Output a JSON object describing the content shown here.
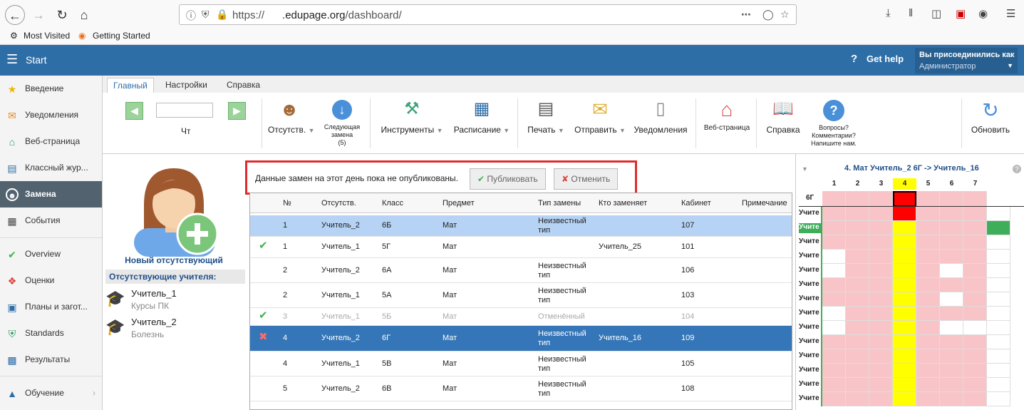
{
  "browser": {
    "url_prefix": "https://",
    "url_domain": ".edupage.org",
    "url_path": "/dashboard/",
    "bookmarks": [
      "Most Visited",
      "Getting Started"
    ]
  },
  "header": {
    "title": "Start",
    "help": "Get help",
    "user_line1": "Вы присоединились как",
    "user_role": "Администратор"
  },
  "sidebar": {
    "items": [
      {
        "label": "Введение",
        "icon": "star-icon",
        "color": "#f0b400"
      },
      {
        "label": "Уведомления",
        "icon": "envelope-icon",
        "color": "#e08a1e"
      },
      {
        "label": "Веб-страница",
        "icon": "home-icon",
        "color": "#2a9d5c"
      },
      {
        "label": "Классный жур...",
        "icon": "journal-icon",
        "color": "#2e6ea7"
      },
      {
        "label": "Замена",
        "icon": "person-icon",
        "color": "#ffffff"
      },
      {
        "label": "События",
        "icon": "calendar-icon",
        "color": "#444444"
      },
      {
        "label": "Overview",
        "icon": "check-circle-icon",
        "color": "#3cb34a"
      },
      {
        "label": "Оценки",
        "icon": "grade-icon",
        "color": "#d9413a"
      },
      {
        "label": "Планы и загот...",
        "icon": "briefcase-icon",
        "color": "#2e6ea7"
      },
      {
        "label": "Standards",
        "icon": "shield-icon",
        "color": "#2a9d5c"
      },
      {
        "label": "Результаты",
        "icon": "bar-chart-icon",
        "color": "#2e6ea7"
      },
      {
        "label": "Обучение",
        "icon": "graduation-icon",
        "color": "#2e6ea7"
      }
    ]
  },
  "tabs": [
    "Главный",
    "Настройки",
    "Справка"
  ],
  "ribbon": {
    "day": "Чт",
    "absent": "Отсутств.",
    "next_line1": "Следующая",
    "next_line2": "замена",
    "next_line3": "(5)",
    "tools": "Инструменты",
    "schedule": "Расписание",
    "print": "Печать",
    "send": "Отправить",
    "notifications": "Уведомления",
    "website": "Веб-страница",
    "help": "Справка",
    "questions_line1": "Вопросы?",
    "questions_line2": "Комментарии?",
    "questions_line3": "Напишите нам.",
    "refresh": "Обновить"
  },
  "left_panel": {
    "new_absent": "Новый отсутствующий",
    "absent_teachers_title": "Отсутствующие учителя:",
    "teachers": [
      {
        "name": "Учитель_1",
        "reason": "Курсы ПК"
      },
      {
        "name": "Учитель_2",
        "reason": "Болезнь"
      }
    ]
  },
  "notice": {
    "text": "Данные замен на этот день пока не опубликованы.",
    "publish": "Публиковать",
    "cancel": "Отменить"
  },
  "table": {
    "columns": [
      "№",
      "Отсутств.",
      "Класс",
      "Предмет",
      "Тип замены",
      "Кто заменяет",
      "Кабинет",
      "Примечание"
    ],
    "rows": [
      {
        "status": "",
        "num": "1",
        "absent": "Учитель_2",
        "class": "6Б",
        "subject": "Мат",
        "type1": "Неизвестный",
        "type2": "тип",
        "sub": "",
        "room": "107",
        "style": "sel-light"
      },
      {
        "status": "check",
        "num": "1",
        "absent": "Учитель_1",
        "class": "5Г",
        "subject": "Мат",
        "type1": "",
        "type2": "",
        "sub": "Учитель_25",
        "room": "101",
        "style": ""
      },
      {
        "status": "",
        "num": "2",
        "absent": "Учитель_2",
        "class": "6А",
        "subject": "Мат",
        "type1": "Неизвестный",
        "type2": "тип",
        "sub": "",
        "room": "106",
        "style": ""
      },
      {
        "status": "",
        "num": "2",
        "absent": "Учитель_1",
        "class": "5А",
        "subject": "Мат",
        "type1": "Неизвестный",
        "type2": "тип",
        "sub": "",
        "room": "103",
        "style": ""
      },
      {
        "status": "check",
        "num": "3",
        "absent": "Учитель_1",
        "class": "5Б",
        "subject": "Мат",
        "type1": "Отменённый",
        "type2": "",
        "sub": "",
        "room": "104",
        "style": "muted"
      },
      {
        "status": "cross",
        "num": "4",
        "absent": "Учитель_2",
        "class": "6Г",
        "subject": "Мат",
        "type1": "Неизвестный",
        "type2": "тип",
        "sub": "Учитель_16",
        "room": "109",
        "style": "sel-dark"
      },
      {
        "status": "",
        "num": "4",
        "absent": "Учитель_1",
        "class": "5В",
        "subject": "Мат",
        "type1": "Неизвестный",
        "type2": "тип",
        "sub": "",
        "room": "105",
        "style": ""
      },
      {
        "status": "",
        "num": "5",
        "absent": "Учитель_2",
        "class": "6В",
        "subject": "Мат",
        "type1": "Неизвестный",
        "type2": "тип",
        "sub": "",
        "room": "108",
        "style": ""
      }
    ]
  },
  "right_panel": {
    "title": "4. Мат Учитель_2 6Г -> Учитель_16",
    "periods": [
      "1",
      "2",
      "3",
      "4",
      "5",
      "6",
      "7"
    ],
    "class_label": "6Г",
    "row_label": "Учите",
    "selected_period": "4",
    "colors": {
      "busy": "#f8c4c8",
      "free": "#ffffff",
      "selected_col": "#ffff00",
      "current": "#ff0000",
      "ok": "#3fae5a"
    }
  }
}
